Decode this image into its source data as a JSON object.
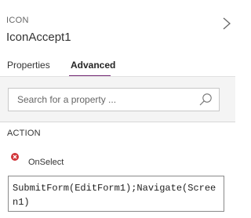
{
  "header": {
    "type_label": "ICON",
    "control_name": "IconAccept1"
  },
  "tabs": [
    {
      "label": "Properties",
      "selected": false
    },
    {
      "label": "Advanced",
      "selected": true
    }
  ],
  "search": {
    "placeholder": "Search for a property ..."
  },
  "section": {
    "title": "ACTION",
    "properties": [
      {
        "label": "OnSelect",
        "formula": "SubmitForm(EditForm1);Navigate(Screen1)",
        "status_icon": "error-icon"
      }
    ]
  },
  "colors": {
    "accent": "#742774",
    "error": "#d13438",
    "search_area": "#f4f4f4"
  },
  "icons": {
    "collapse": "chevron-right-icon",
    "search": "search-icon",
    "status": "error-icon"
  }
}
